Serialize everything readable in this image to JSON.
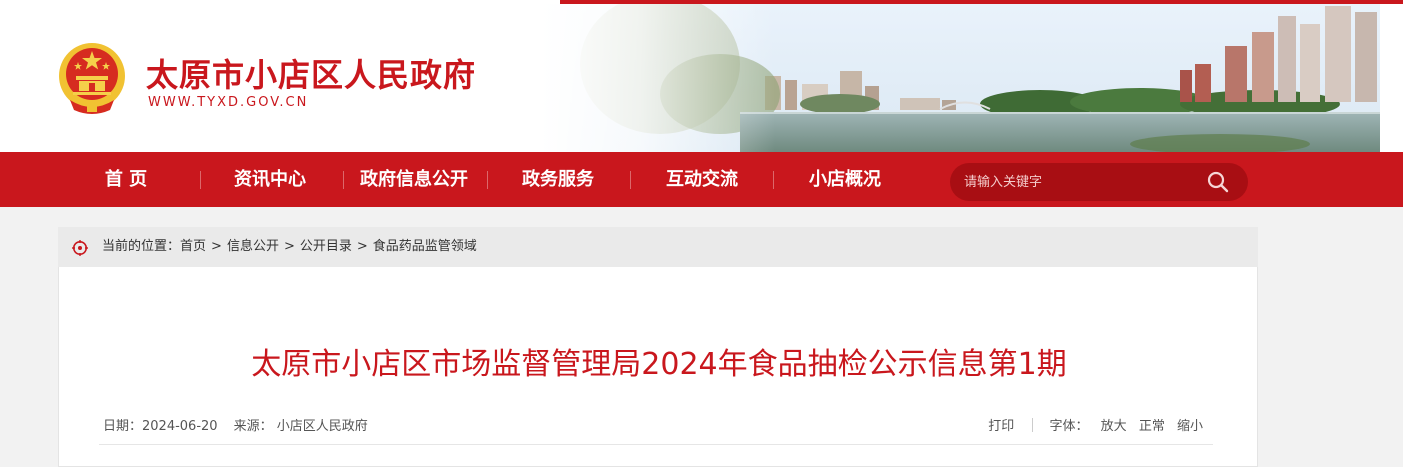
{
  "site": {
    "title": "太原市小店区人民政府",
    "url": "WWW.TYXD.GOV.CN"
  },
  "nav": {
    "items": [
      "首 页",
      "资讯中心",
      "政府信息公开",
      "政务服务",
      "互动交流",
      "小店概况"
    ]
  },
  "search": {
    "placeholder": "请输入关键字"
  },
  "breadcrumb": {
    "prefix": "当前的位置：",
    "items": [
      "首页",
      "信息公开",
      "公开目录",
      "食品药品监管领域"
    ],
    "separator": ">"
  },
  "article": {
    "title": "太原市小店区市场监督管理局2024年食品抽检公示信息第1期",
    "date_label": "日期：",
    "date": "2024-06-20",
    "source_label": "来源：",
    "source": "小店区人民政府"
  },
  "tools": {
    "print": "打印",
    "font_label": "字体：",
    "font_large": "放大",
    "font_normal": "正常",
    "font_small": "缩小"
  },
  "colors": {
    "brand_red": "#c9171d",
    "search_bg": "#a80e13"
  }
}
